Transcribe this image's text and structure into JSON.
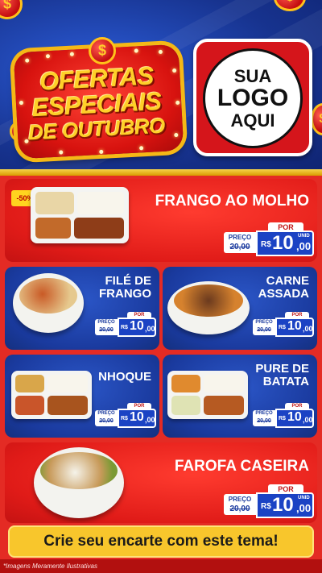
{
  "header": {
    "title_line1": "OFERTAS",
    "title_line2": "ESPECIAIS",
    "title_line3": "DE OUTUBRO",
    "logo_line1": "SUA",
    "logo_line2": "LOGO",
    "logo_line3": "AQUI",
    "coin_symbol": "$"
  },
  "colors": {
    "header_blue": "#1b3c9e",
    "accent_red": "#e01b18",
    "gold": "#f8c62c",
    "price_blue": "#1b43c4"
  },
  "products": [
    {
      "name_line1": "FRANGO AO MOLHO",
      "name_line2": "",
      "discount": "-50%",
      "por_label": "POR",
      "price_label": "PREÇO",
      "currency_old": "R$",
      "old_price": "20,00",
      "currency": "R$",
      "price_int": "10",
      "price_dec": ",00",
      "unit": "UNID"
    },
    {
      "name_line1": "FILÉ DE",
      "name_line2": "FRANGO",
      "por_label": "POR",
      "price_label": "PREÇO",
      "currency_old": "R$",
      "old_price": "20,00",
      "currency": "R$",
      "price_int": "10",
      "price_dec": ",00",
      "unit": "UNID"
    },
    {
      "name_line1": "CARNE",
      "name_line2": "ASSADA",
      "por_label": "POR",
      "price_label": "PREÇO",
      "currency_old": "R$",
      "old_price": "20,00",
      "currency": "R$",
      "price_int": "10",
      "price_dec": ",00",
      "unit": "UNID"
    },
    {
      "name_line1": "NHOQUE",
      "name_line2": "",
      "por_label": "POR",
      "price_label": "PREÇO",
      "currency_old": "R$",
      "old_price": "20,00",
      "currency": "R$",
      "price_int": "10",
      "price_dec": ",00",
      "unit": "UNID"
    },
    {
      "name_line1": "PURE DE",
      "name_line2": "BATATA",
      "por_label": "POR",
      "price_label": "PREÇO",
      "currency_old": "R$",
      "old_price": "20,00",
      "currency": "R$",
      "price_int": "10",
      "price_dec": ",00",
      "unit": "UNID"
    },
    {
      "name_line1": "FAROFA CASEIRA",
      "name_line2": "",
      "por_label": "POR",
      "price_label": "PREÇO",
      "currency_old": "R$",
      "old_price": "20,00",
      "currency": "R$",
      "price_int": "10",
      "price_dec": ",00",
      "unit": "UNID"
    }
  ],
  "footer": {
    "cta": "Crie seu encarte com este tema!",
    "disclaimer": "*Imagens Meramente Ilustrativas"
  }
}
